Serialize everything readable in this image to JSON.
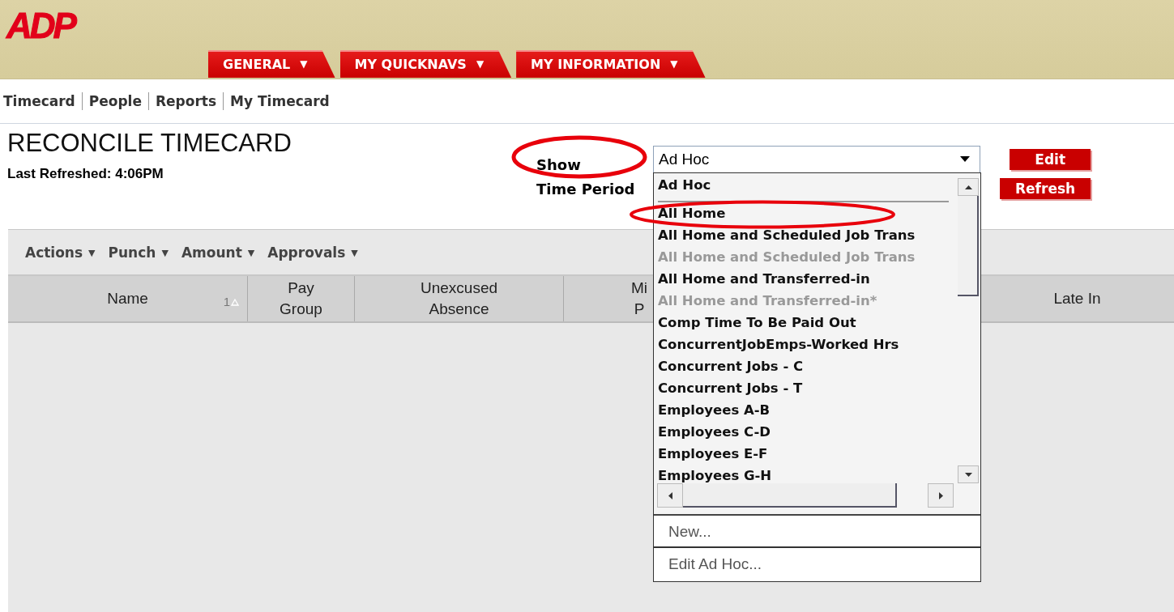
{
  "logo": "ADP",
  "tabs": [
    {
      "label": "GENERAL",
      "caret": "▼"
    },
    {
      "label": "MY QUICKNAVS",
      "caret": "▼"
    },
    {
      "label": "MY INFORMATION",
      "caret": "▼"
    }
  ],
  "nav_links": [
    "Timecard",
    "People",
    "Reports",
    "My Timecard"
  ],
  "page_title": "RECONCILE TIMECARD",
  "last_refreshed": "Last Refreshed: 4:06PM",
  "show_label": "Show",
  "show_value": "Ad Hoc",
  "time_period_label": "Time Period",
  "edit_button": "Edit",
  "refresh_button": "Refresh",
  "toolbar_menus": [
    {
      "label": "Actions",
      "caret": "▼"
    },
    {
      "label": "Punch",
      "caret": "▼"
    },
    {
      "label": "Amount",
      "caret": "▼"
    },
    {
      "label": "Approvals",
      "caret": "▼"
    }
  ],
  "columns": [
    {
      "lines": [
        "Name"
      ],
      "sort": "1"
    },
    {
      "lines": [
        "Pay",
        "Group"
      ]
    },
    {
      "lines": [
        "Unexcused",
        "Absence"
      ]
    },
    {
      "lines": [
        "Mi",
        "P"
      ]
    },
    {},
    {
      "lines": [
        "Late In"
      ]
    }
  ],
  "dropdown_items": [
    {
      "label": "Ad Hoc",
      "selected": true,
      "disabled": false
    },
    {
      "label": "All Home",
      "selected": false,
      "disabled": false
    },
    {
      "label": "All Home and Scheduled Job Trans",
      "selected": false,
      "disabled": false
    },
    {
      "label": "All Home and Scheduled Job Trans",
      "selected": false,
      "disabled": true
    },
    {
      "label": "All Home and Transferred-in",
      "selected": false,
      "disabled": false
    },
    {
      "label": "All Home and Transferred-in*",
      "selected": false,
      "disabled": true
    },
    {
      "label": "Comp Time To Be Paid Out",
      "selected": false,
      "disabled": false
    },
    {
      "label": "ConcurrentJobEmps-Worked Hrs",
      "selected": false,
      "disabled": false
    },
    {
      "label": "Concurrent Jobs - C",
      "selected": false,
      "disabled": false
    },
    {
      "label": "Concurrent Jobs - T",
      "selected": false,
      "disabled": false
    },
    {
      "label": "Employees A-B",
      "selected": false,
      "disabled": false
    },
    {
      "label": "Employees C-D",
      "selected": false,
      "disabled": false
    },
    {
      "label": "Employees E-F",
      "selected": false,
      "disabled": false
    },
    {
      "label": "Employees G-H",
      "selected": false,
      "disabled": false
    }
  ],
  "dropdown_actions": [
    "New...",
    "Edit Ad Hoc..."
  ]
}
